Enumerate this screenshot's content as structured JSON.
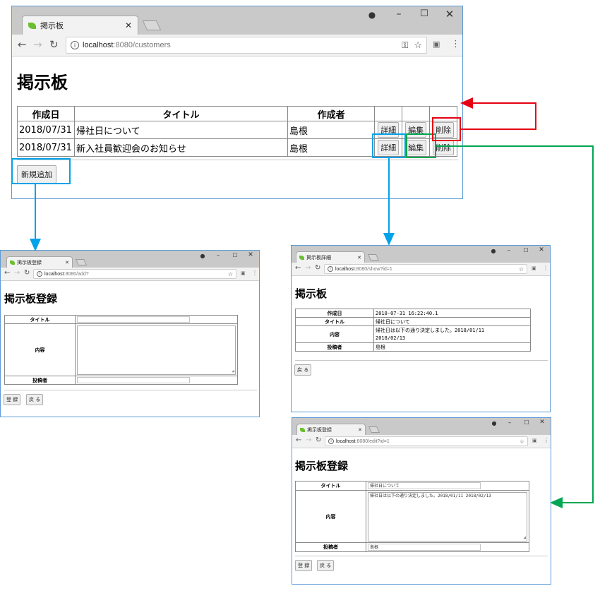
{
  "colors": {
    "blue": "#00a2e8",
    "red": "#e60012",
    "green": "#00a652",
    "frame": "#5b9bd5"
  },
  "main": {
    "tab_title": "掲示板",
    "url_host": "localhost",
    "url_path": ":8080/customers",
    "heading": "掲示板",
    "columns": [
      "作成日",
      "タイトル",
      "作成者"
    ],
    "rows": [
      {
        "date": "2018/07/31",
        "title": "帰社日について",
        "author": "島根",
        "detail": "詳細",
        "edit": "編集",
        "delete": "削除"
      },
      {
        "date": "2018/07/31",
        "title": "新入社員歓迎会のお知らせ",
        "author": "島根",
        "detail": "詳細",
        "edit": "編集",
        "delete": "削除"
      }
    ],
    "add_button": "新規追加"
  },
  "add_page": {
    "tab_title": "掲示板登録",
    "url_host": "localhost",
    "url_path": ":8080/add?",
    "heading": "掲示板登録",
    "labels": {
      "title": "タイトル",
      "content": "内容",
      "author": "投稿者"
    },
    "register_button": "登 録",
    "back_button": "戻 る"
  },
  "show_page": {
    "tab_title": "掲示板詳細",
    "url_host": "localhost",
    "url_path": ":8080/show?id=1",
    "heading": "掲示板",
    "rows": [
      {
        "label": "作成日",
        "value": "2018-07-31 16:22:40.1"
      },
      {
        "label": "タイトル",
        "value": "帰社日について"
      },
      {
        "label": "内容",
        "value": "帰社日は以下の通り決定しました。2018/01/11\n2018/02/13"
      },
      {
        "label": "投稿者",
        "value": "島根"
      }
    ],
    "back_button": "戻 る"
  },
  "edit_page": {
    "tab_title": "掲示板登録",
    "url_host": "localhost",
    "url_path": ":8080/edit?id=1",
    "heading": "掲示板登録",
    "labels": {
      "title": "タイトル",
      "content": "内容",
      "author": "投稿者"
    },
    "values": {
      "title": "帰社日について",
      "content": "帰社日は以下の通り決定しました。2018/01/11 2018/02/13",
      "author": "島根"
    },
    "register_button": "登 録",
    "back_button": "戻 る"
  }
}
